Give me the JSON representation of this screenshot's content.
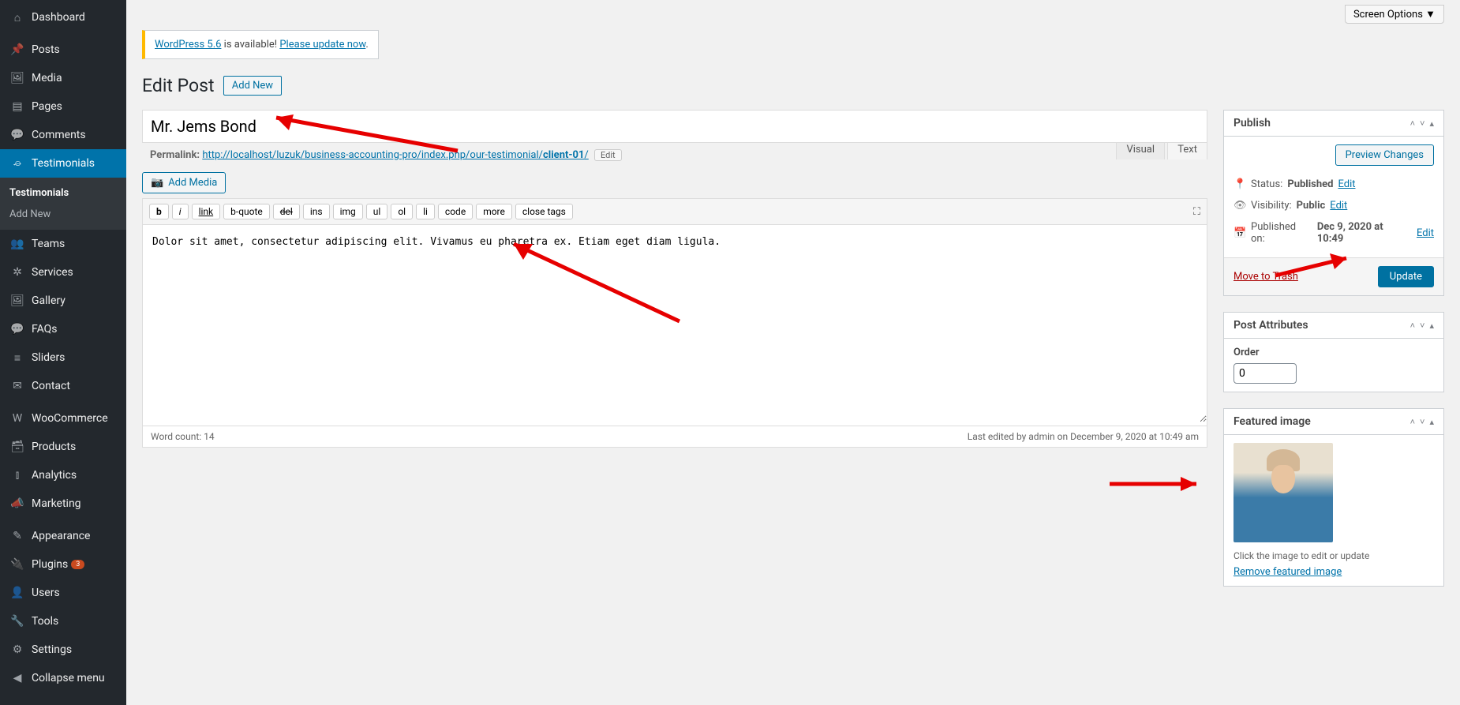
{
  "topbar": {
    "screen_options": "Screen Options ▼"
  },
  "notice": {
    "before": "WordPress 5.6",
    "mid": " is available! ",
    "link": "Please update now"
  },
  "heading": "Edit Post",
  "add_new": "Add New",
  "title_value": "Mr. Jems Bond",
  "permalink": {
    "label": "Permalink:",
    "base": "http://localhost/luzuk/business-accounting-pro/index.php/our-testimonial/",
    "slug": "client-01",
    "edit": "Edit"
  },
  "media_btn": "Add Media",
  "tabs": {
    "visual": "Visual",
    "text": "Text"
  },
  "quicktags": [
    "b",
    "i",
    "link",
    "b-quote",
    "del",
    "ins",
    "img",
    "ul",
    "ol",
    "li",
    "code",
    "more",
    "close tags"
  ],
  "content": "Dolor sit amet, consectetur adipiscing elit. Vivamus eu pharetra ex. Etiam eget diam ligula.",
  "footer": {
    "wordcount": "Word count: 14",
    "lastedit": "Last edited by admin on December 9, 2020 at 10:49 am"
  },
  "sidebar": {
    "items": [
      {
        "icon": "⌂",
        "label": "Dashboard"
      },
      {
        "sep": true
      },
      {
        "icon": "📌",
        "label": "Posts"
      },
      {
        "icon": "🖼",
        "label": "Media"
      },
      {
        "icon": "▤",
        "label": "Pages"
      },
      {
        "icon": "💬",
        "label": "Comments"
      },
      {
        "icon": "⌮",
        "label": "Testimonials",
        "current": true
      },
      {
        "icon": "👥",
        "label": "Teams"
      },
      {
        "icon": "✲",
        "label": "Services"
      },
      {
        "icon": "🖼",
        "label": "Gallery"
      },
      {
        "icon": "💬",
        "label": "FAQs"
      },
      {
        "icon": "≡",
        "label": "Sliders"
      },
      {
        "icon": "✉",
        "label": "Contact"
      },
      {
        "sep": true
      },
      {
        "icon": "W",
        "label": "WooCommerce"
      },
      {
        "icon": "🗃",
        "label": "Products"
      },
      {
        "icon": "⫾",
        "label": "Analytics"
      },
      {
        "icon": "📣",
        "label": "Marketing"
      },
      {
        "sep": true
      },
      {
        "icon": "✎",
        "label": "Appearance"
      },
      {
        "icon": "🔌",
        "label": "Plugins",
        "badge": "3"
      },
      {
        "icon": "👤",
        "label": "Users"
      },
      {
        "icon": "🔧",
        "label": "Tools"
      },
      {
        "icon": "⚙",
        "label": "Settings"
      },
      {
        "icon": "◀",
        "label": "Collapse menu"
      }
    ],
    "submenu": [
      {
        "label": "Testimonials",
        "active": true
      },
      {
        "label": "Add New"
      }
    ]
  },
  "publish": {
    "title": "Publish",
    "preview": "Preview Changes",
    "status_label": "Status:",
    "status_val": "Published",
    "status_edit": "Edit",
    "vis_label": "Visibility:",
    "vis_val": "Public",
    "vis_edit": "Edit",
    "pub_label": "Published on:",
    "pub_val": "Dec 9, 2020 at 10:49",
    "pub_edit": "Edit",
    "trash": "Move to Trash",
    "update": "Update"
  },
  "attributes": {
    "title": "Post Attributes",
    "order_label": "Order",
    "order_val": "0"
  },
  "featured": {
    "title": "Featured image",
    "hint": "Click the image to edit or update",
    "remove": "Remove featured image"
  }
}
